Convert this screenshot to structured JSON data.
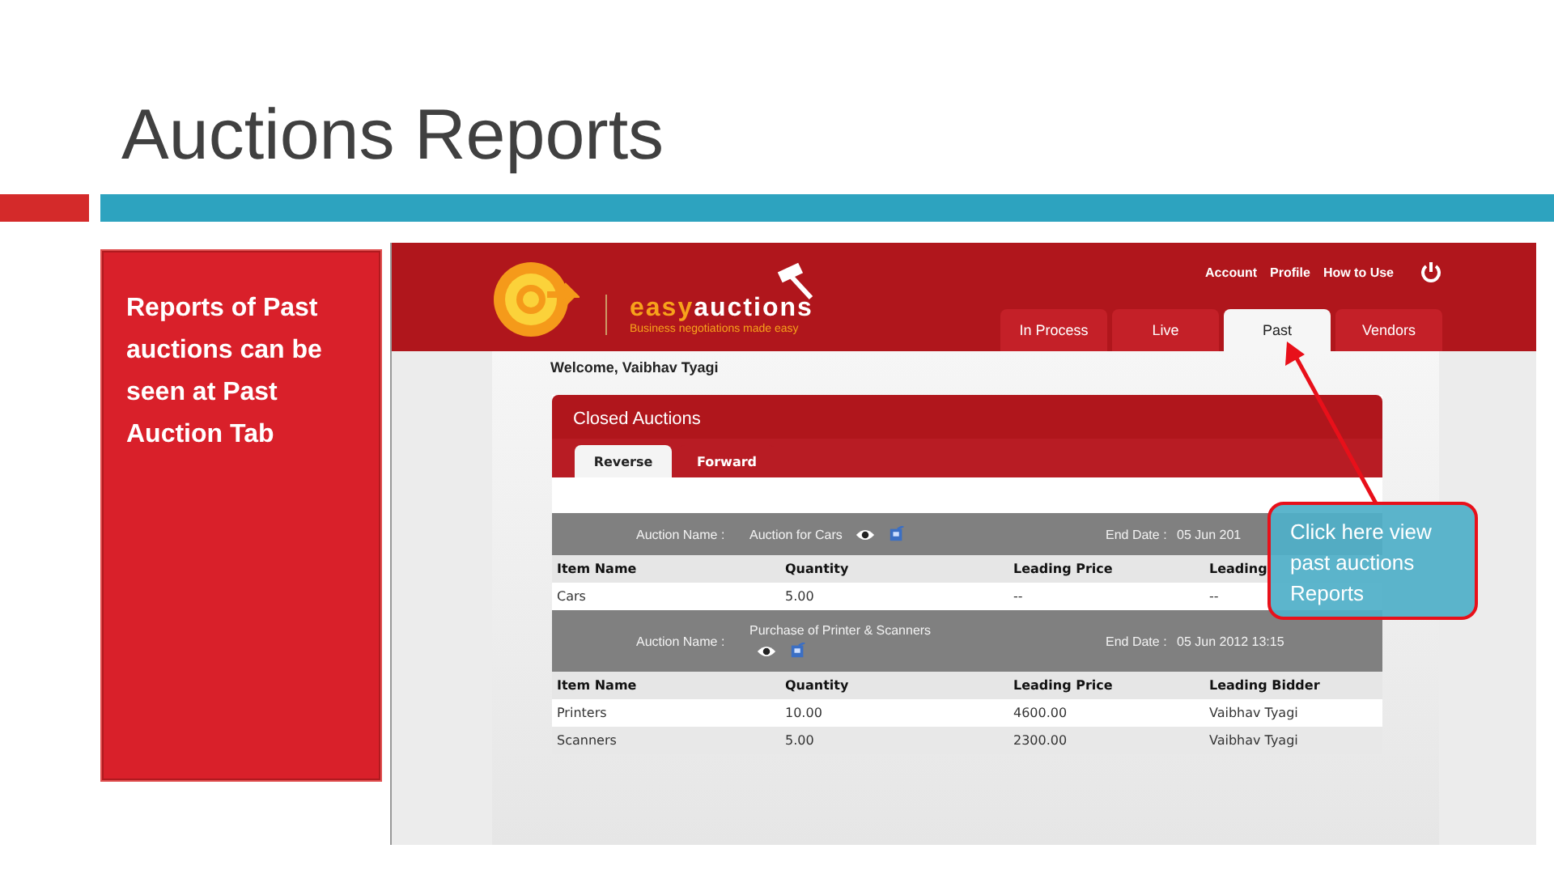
{
  "slide": {
    "title": "Auctions Reports",
    "note": "Reports of Past auctions can be seen at Past Auction Tab"
  },
  "app": {
    "brand": {
      "part1": "easy",
      "part2": "auctions",
      "tagline": "Business negotiations made easy"
    },
    "top_links": [
      "Account",
      "Profile",
      "How to Use"
    ],
    "tabs": [
      {
        "label": "In Process",
        "selected": false
      },
      {
        "label": "Live",
        "selected": false
      },
      {
        "label": "Past",
        "selected": true
      },
      {
        "label": "Vendors",
        "selected": false
      }
    ],
    "welcome": "Welcome, Vaibhav Tyagi",
    "panel": {
      "title": "Closed Auctions",
      "subtabs": [
        {
          "label": "Reverse",
          "selected": true
        },
        {
          "label": "Forward",
          "selected": false
        }
      ],
      "auctions": [
        {
          "name_label": "Auction Name :",
          "name": "Auction for Cars",
          "end_label": "End Date :",
          "end_date": "05 Jun 201",
          "columns": [
            "Item Name",
            "Quantity",
            "Leading Price",
            "Leading"
          ],
          "rows": [
            [
              "Cars",
              "5.00",
              "--",
              "--"
            ]
          ]
        },
        {
          "name_label": "Auction Name :",
          "name": "Purchase of Printer & Scanners",
          "end_label": "End Date :",
          "end_date": "05 Jun 2012 13:15",
          "columns": [
            "Item Name",
            "Quantity",
            "Leading Price",
            "Leading Bidder"
          ],
          "rows": [
            [
              "Printers",
              "10.00",
              "4600.00",
              "Vaibhav Tyagi"
            ],
            [
              "Scanners",
              "5.00",
              "2300.00",
              "Vaibhav Tyagi"
            ]
          ]
        }
      ]
    }
  },
  "callout": "Click here view past auctions Reports"
}
